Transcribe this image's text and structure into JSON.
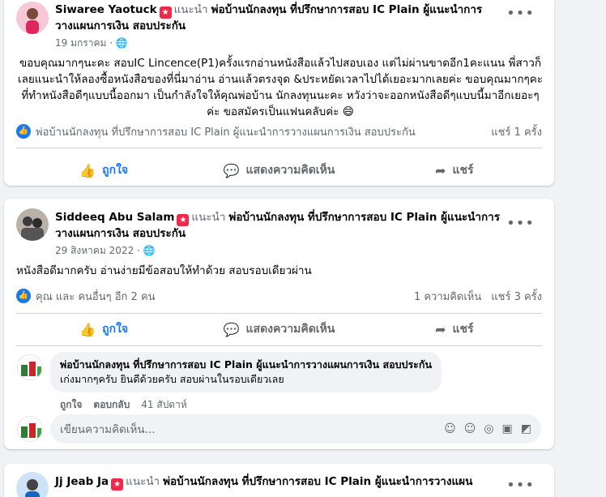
{
  "posts": [
    {
      "author": "Siwaree Yaotuck",
      "recommends": "แนะนำ",
      "page": "พ่อบ้านนักลงทุน ที่ปรึกษาการสอบ IC Plain ผู้แนะนำการวางแผนการเงิน สอบประกัน",
      "date": "19 มกราคม",
      "privacy_icon": "globe-icon",
      "text": "ขอบคุณมากๆนะคะ สอบIC Lincence(P1)ครั้งแรกอ่านหนังสือแล้วไปสอบเอง แต่ไม่ผ่านขาดอีก1คะแนน พี่สาวก็เลยแนะนำให้ลองซื้อหนังสือของที่นี่มาอ่าน อ่านแล้วตรงจุด &ประหยัดเวลาไปได้เยอะมากเลยค่ะ ขอบคุณมากๆคะที่ทำหนังสือดีๆแบบนี้ออกมา เป็นกำลังใจให้คุณพ่อบ้าน นักลงทุนนะคะ หวังว่าจะออกหนังสือดีๆแบบนี้มาอีกเยอะๆค่ะ ขอสมัครเป็นแฟนคลับค่ะ 😄",
      "reactors": "พ่อบ้านนักลงทุน ที่ปรึกษาการสอบ IC Plain ผู้แนะนำการวางแผนการเงิน สอบประกัน",
      "shares": "แชร์ 1 ครั้ง",
      "like_label": "ถูกใจ",
      "comment_label": "แสดงความคิดเห็น",
      "share_label": "แชร์"
    },
    {
      "author": "Siddeeq Abu Salam",
      "recommends": "แนะนำ",
      "page": "พ่อบ้านนักลงทุน ที่ปรึกษาการสอบ IC Plain ผู้แนะนำการวางแผนการเงิน สอบประกัน",
      "date": "29 สิงหาคม 2022",
      "privacy_icon": "globe-icon",
      "text": "หนังสือดีมากครับ อ่านง่ายมีข้อสอบให้ทำด้วย สอบรอบเดียวผ่าน",
      "reactors": "คุณ และ คนอื่นๆ อีก 2 คน",
      "comments_count": "1 ความคิดเห็น",
      "shares": "แชร์ 3 ครั้ง",
      "like_label": "ถูกใจ",
      "comment_label": "แสดงความคิดเห็น",
      "share_label": "แชร์",
      "comment": {
        "author": "พ่อบ้านนักลงทุน ที่ปรึกษาการสอบ IC Plain ผู้แนะนำการวางแผนการเงิน สอบประกัน",
        "text": "เก่งมากๆครับ ยินดีด้วยครับ สอบผ่านในรอบเดียวเลย",
        "like": "ถูกใจ",
        "reply": "ตอบกลับ",
        "time": "41 สัปดาห์"
      },
      "input_placeholder": "เขียนความคิดเห็น..."
    },
    {
      "author": "Jj Jeab Ja",
      "recommends": "แนะนำ",
      "page": "พ่อบ้านนักลงทุน ที่ปรึกษาการสอบ IC Plain ผู้แนะนำการวางแผน"
    }
  ],
  "colors": {
    "accent": "#1877f2",
    "muted": "#65676b",
    "badge": "#f02849"
  }
}
